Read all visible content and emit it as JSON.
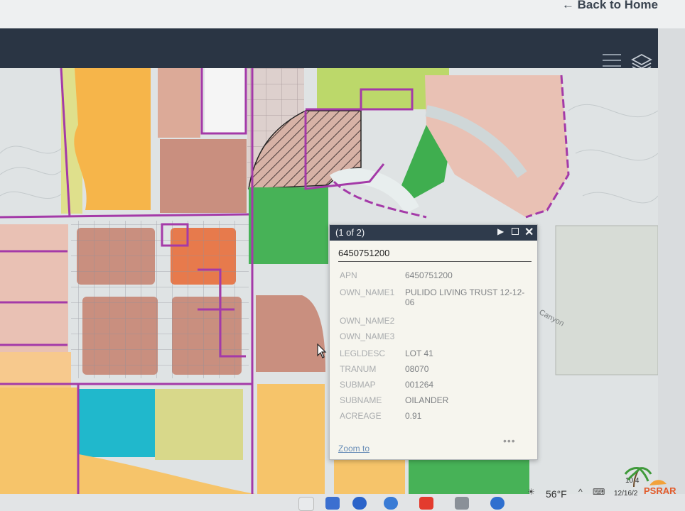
{
  "header": {
    "back_label": "← Back to Home"
  },
  "popup": {
    "counter": "(1 of 2)",
    "title": "6450751200",
    "fields": [
      {
        "label": "APN",
        "value": "6450751200"
      },
      {
        "label": "OWN_NAME1",
        "value": "PULIDO LIVING TRUST 12-12-06"
      },
      {
        "label": "OWN_NAME2",
        "value": ""
      },
      {
        "label": "OWN_NAME3",
        "value": ""
      },
      {
        "label": "LEGLDESC",
        "value": "LOT 41"
      },
      {
        "label": "TRANUM",
        "value": "08070"
      },
      {
        "label": "SUBMAP",
        "value": "001264"
      },
      {
        "label": "SUBNAME",
        "value": "OILANDER"
      },
      {
        "label": "ACREAGE",
        "value": "0.91"
      }
    ],
    "zoom_label": "Zoom to",
    "more_label": "•••"
  },
  "map": {
    "road_label": "Canyon"
  },
  "taskbar": {
    "temperature": "56°F",
    "time": "10:4",
    "date": "12/16/2"
  },
  "watermark": {
    "text": "PSRAR"
  },
  "colors": {
    "header": "#2a3544",
    "popup_header": "#2f3b4c",
    "parcel_boundary": "#a43aa8",
    "commercial": "#c98f7f",
    "residential": "#e9c1b4",
    "industrial_orange": "#e77a4c",
    "park_green": "#47b257",
    "yellow_light": "#d8d88a",
    "orange_yellow": "#f6b54a"
  },
  "icons": [
    "layers-icon",
    "next-arrow-icon",
    "maximize-icon",
    "close-icon",
    "mouse-cursor-icon"
  ]
}
